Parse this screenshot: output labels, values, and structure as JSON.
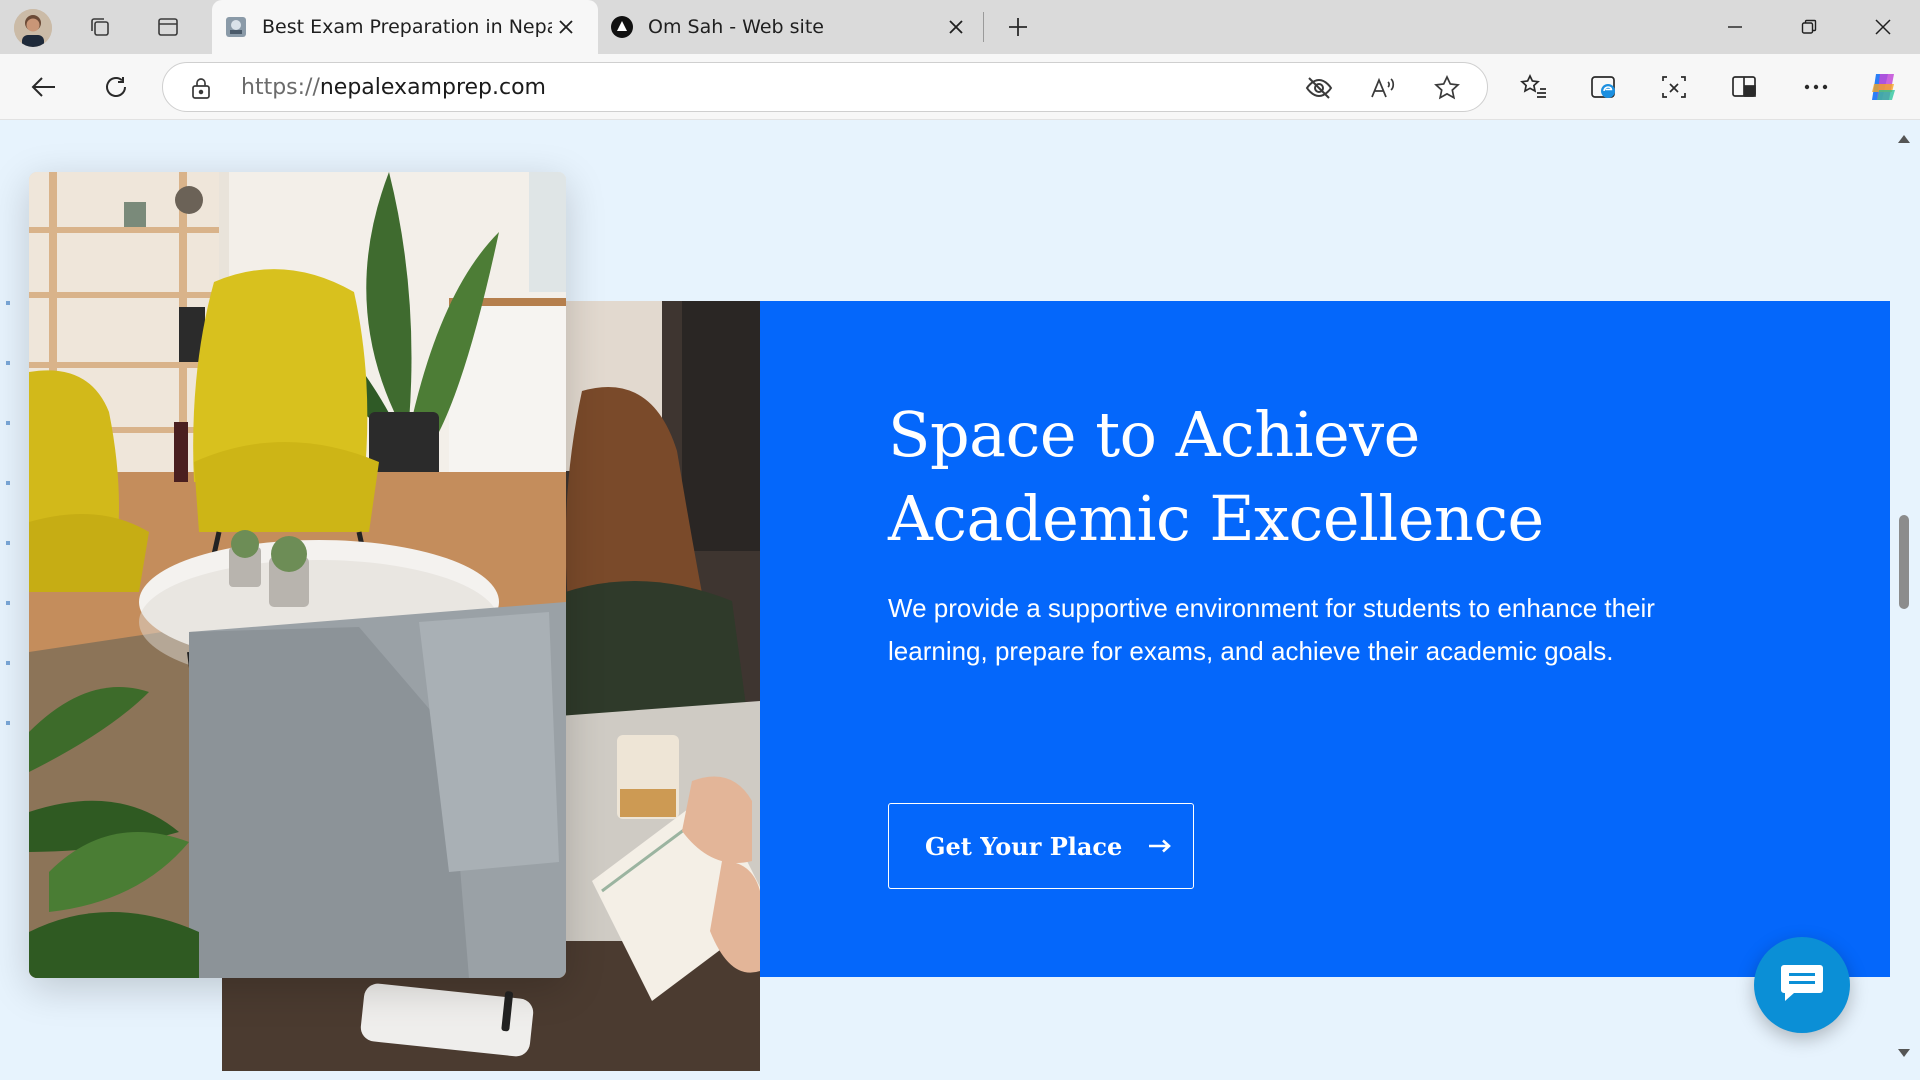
{
  "browser": {
    "tabs": [
      {
        "title": "Best Exam Preparation in Nepal | E",
        "active": true
      },
      {
        "title": "Om Sah - Web site",
        "active": false
      }
    ],
    "address_bar": {
      "scheme": "https://",
      "host": "nepalexamprep.com"
    },
    "icons": {
      "profile": "avatar",
      "workspaces": "workspaces-icon",
      "tab_actions": "vertical-tabs-icon",
      "new_tab": "plus-icon",
      "back": "back-arrow-icon",
      "refresh": "refresh-icon",
      "site_info": "lock-icon",
      "tracking": "eye-slash-icon",
      "read_aloud": "read-aloud-icon",
      "favorite": "star-icon",
      "favorites": "favorites-list-icon",
      "edge_shopping": "edge-icon",
      "screenshot": "screenshot-icon",
      "split_screen": "split-screen-icon",
      "more": "more-icon",
      "copilot": "copilot-icon"
    }
  },
  "hero": {
    "headline_line1": "Space to Achieve",
    "headline_line2": "Academic Excellence",
    "lead_line1": "We provide a supportive environment for students to enhance their",
    "lead_line2": "learning, prepare for exams, and achieve their academic goals.",
    "cta_label": "Get Your Place",
    "panel_color": "#0467fb"
  },
  "chat_widget": {
    "icon": "chat-bubble-icon",
    "color": "#0b8fd6"
  }
}
